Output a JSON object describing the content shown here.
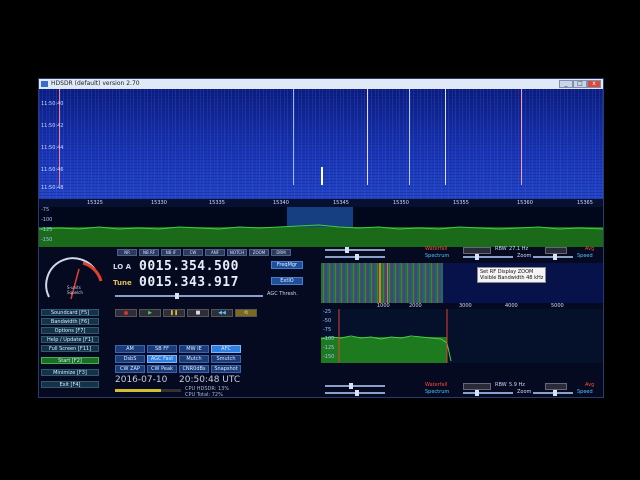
{
  "window": {
    "title": "HDSDR (default)  version 2.70",
    "buttons": {
      "minimize": "_",
      "maximize": "□",
      "close": "x"
    }
  },
  "waterfall": {
    "y_ticks": [
      "11:50:40",
      "11:50:42",
      "11:50:44",
      "11:50:46",
      "11:50:48"
    ],
    "x_ticks": [
      "15325",
      "15330",
      "15335",
      "15340",
      "15345",
      "15350",
      "15355",
      "15360",
      "15365"
    ]
  },
  "spectrum": {
    "y_ticks": [
      "-75",
      "-100",
      "-125",
      "-150"
    ]
  },
  "side_panel": {
    "buttons": [
      {
        "label": "Soundcard  [F5]",
        "active": false
      },
      {
        "label": "Bandwidth  [F6]",
        "active": false
      },
      {
        "label": "Options  [F7]",
        "active": false
      },
      {
        "label": "Help / Update  [F1]",
        "active": false
      },
      {
        "label": "Full Screen  [F11]",
        "active": false
      },
      {
        "label": "Start  [F2]",
        "active": true
      },
      {
        "label": "Minimize  [F3]",
        "active": false
      },
      {
        "label": "Exit  [F4]",
        "active": false
      }
    ],
    "smeter_caption": "S-units\nSquelch"
  },
  "tuning": {
    "lo_label": "LO A",
    "lo_value": "0015.354.500",
    "tune_label": "Tune",
    "tune_value": "0015.343.917",
    "freq_mgr": "FreqMgr",
    "extio": "ExtIO",
    "agc_thresh": "AGC Thresh."
  },
  "top_buttons": [
    "NR",
    "NB RF",
    "NB IF",
    "CW",
    "ANF",
    "NOTCH",
    "ZOOM",
    "DRM"
  ],
  "transport": {
    "buttons": [
      "record",
      "play",
      "pause",
      "stop",
      "loop",
      "loop-alt"
    ]
  },
  "modes": [
    "AM",
    "SB FF",
    "MW IE",
    "AFC",
    "DsbS",
    "AGC Fast",
    "Mutch",
    "Smutch",
    "CW ZAP",
    "CW Peak",
    "CNR0dBs",
    "Snapshot"
  ],
  "status": {
    "date": "2016-07-10",
    "time": "20:50:48 UTC",
    "cpu_hdsdr": "CPU HDSDR:  13%",
    "cpu_total": "CPU Total:  72%"
  },
  "rf_controls_top": {
    "waterfall": "Waterfall",
    "spectrum": "Spectrum",
    "zoom": "Zoom",
    "rbw_label": "RBW",
    "rbw_value": "27.1 Hz",
    "avg": "Avg",
    "speed": "Speed"
  },
  "af_axis": [
    "1000",
    "2000",
    "3000",
    "4000",
    "5000"
  ],
  "af_spectrum_y": [
    "-25",
    "-50",
    "-75",
    "-100",
    "-125",
    "-150"
  ],
  "tooltip": [
    "Set RF Display ZOOM",
    "Visible Bandwidth 48 kHz"
  ],
  "rf_controls_bottom": {
    "waterfall": "Waterfall",
    "spectrum": "Spectrum",
    "zoom": "Zoom",
    "rbw_label": "RBW",
    "rbw_value": "5.9 Hz",
    "avg": "Avg",
    "speed": "Speed"
  },
  "colors": {
    "accent_blue": "#2f7fe0",
    "active_green": "#1c6d28",
    "marker_red": "#ff4a3a",
    "spectrum_green": "#2fa82f"
  }
}
